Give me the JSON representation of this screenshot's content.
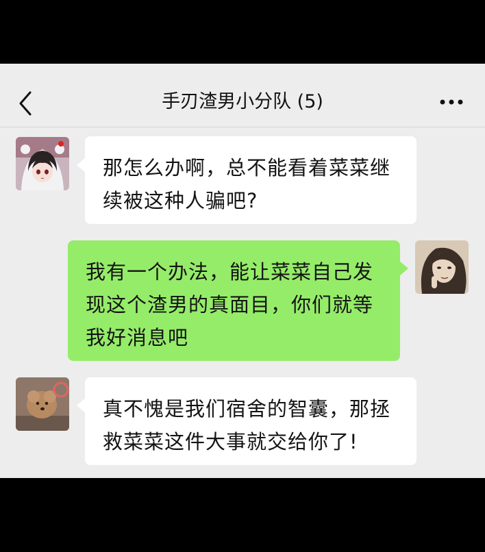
{
  "header": {
    "title": "手刃渣男小分队 (5)",
    "back_icon": "chevron-left-icon",
    "more_icon": "more-dots-icon"
  },
  "messages": [
    {
      "side": "left",
      "avatar": "anime-girl-avatar",
      "lines": [
        "那怎么办啊，总不能看着菜菜继",
        "续被这种人骗吧?"
      ]
    },
    {
      "side": "right",
      "avatar": "sketch-girl-avatar",
      "lines": [
        "我有一个办法，能让菜菜自己发",
        "现这个渣男的真面目，你们就等",
        "我好消息吧"
      ]
    },
    {
      "side": "left",
      "avatar": "dog-avatar",
      "lines": [
        "真不愧是我们宿舍的智囊，那拯",
        "救菜菜这件大事就交给你了!"
      ]
    }
  ],
  "colors": {
    "background": "#ededed",
    "bubble_self": "#95ec69",
    "bubble_other": "#ffffff",
    "letterbox": "#000000"
  }
}
